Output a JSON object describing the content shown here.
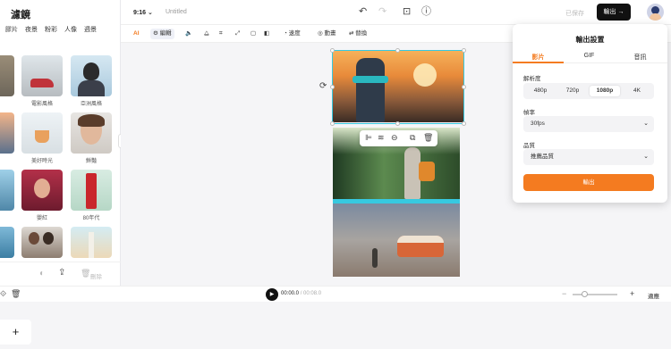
{
  "left_panel": {
    "title": "濾鏡",
    "categories": [
      "膠片",
      "夜景",
      "粉彩",
      "人像",
      "週景"
    ],
    "filters": [
      {
        "label": ""
      },
      {
        "label": "電影風格"
      },
      {
        "label": "亞洲風格"
      },
      {
        "label": ""
      },
      {
        "label": "美好時光"
      },
      {
        "label": "鮮豔"
      },
      {
        "label": ""
      },
      {
        "label": "嬰紅"
      },
      {
        "label": "80年代"
      },
      {
        "label": ""
      },
      {
        "label": ""
      },
      {
        "label": ""
      }
    ],
    "delete_label": "刪除"
  },
  "topbar": {
    "ratio": "9:16",
    "title": "Untitled",
    "saved": "已保存",
    "export_label": "輸出"
  },
  "toolbar": {
    "edit": "編輯",
    "speed": "速度",
    "animation": "動畫",
    "replace": "替換"
  },
  "export_panel": {
    "title": "輸出設置",
    "tabs": [
      "影片",
      "GIF",
      "音訊"
    ],
    "resolution_label": "解析度",
    "resolutions": [
      "480p",
      "720p",
      "1080p",
      "4K"
    ],
    "selected_resolution": "1080p",
    "framerate_label": "幀率",
    "framerate_value": "30fps",
    "quality_label": "品質",
    "quality_value": "推薦品質",
    "export_button": "輸出"
  },
  "timeline": {
    "current": "00:00.0",
    "duration": "/ 00:08.0",
    "fit_label": "適應"
  },
  "colors": {
    "accent": "#f47b20",
    "selection": "#37c9e0"
  }
}
